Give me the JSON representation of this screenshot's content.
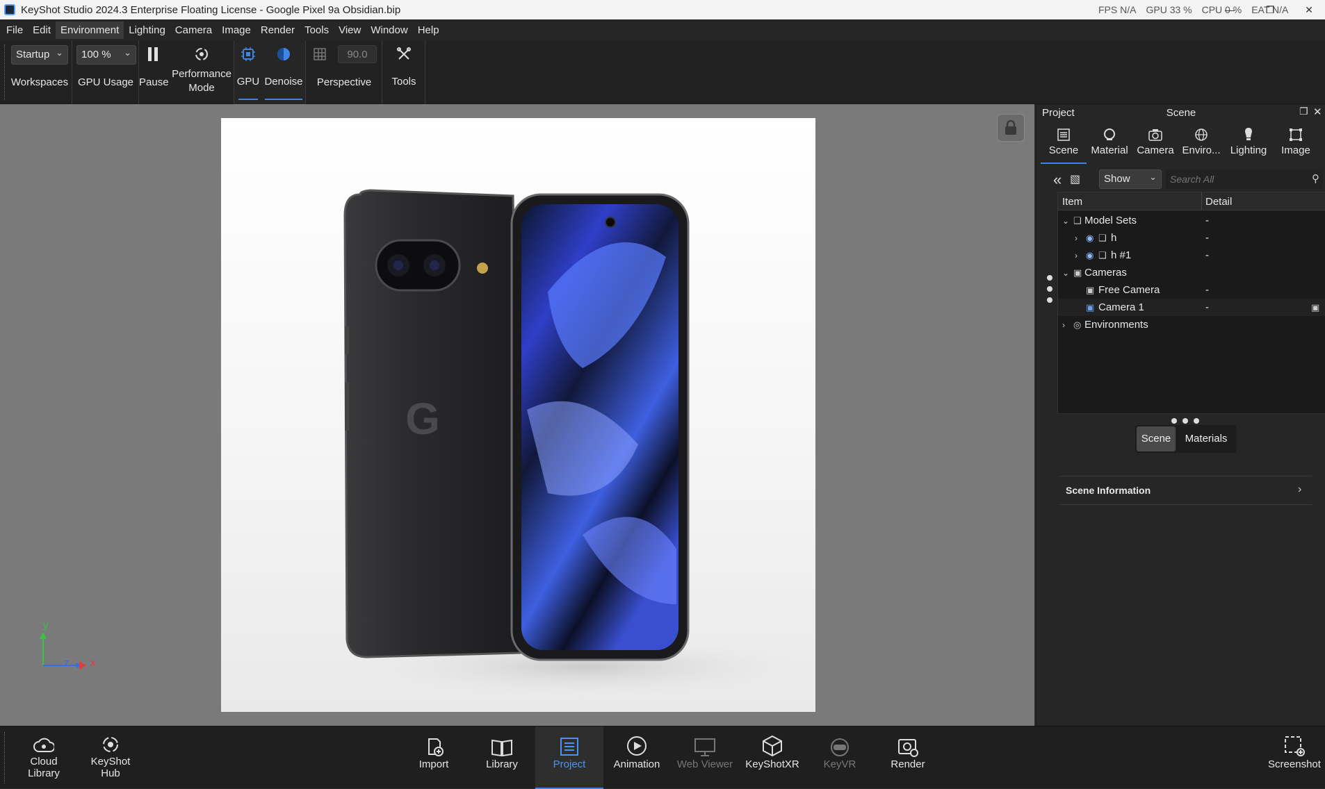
{
  "window": {
    "title": "KeyShot Studio 2024.3 Enterprise Floating License  - Google Pixel 9a Obsidian.bip",
    "stats": [
      "FPS N/A",
      "GPU 33 %",
      "CPU 0 %",
      "EAT N/A"
    ]
  },
  "menu": [
    "File",
    "Edit",
    "Environment",
    "Lighting",
    "Camera",
    "Image",
    "Render",
    "Tools",
    "View",
    "Window",
    "Help"
  ],
  "ribbon": {
    "workspace_value": "Startup",
    "workspaces_label": "Workspaces",
    "gpu_usage_value": "100 %",
    "gpu_usage_label": "GPU Usage",
    "pause_label": "Pause",
    "performance_label_1": "Performance",
    "performance_label_2": "Mode",
    "gpu_label": "GPU",
    "denoise_label": "Denoise",
    "fov_value": "90.0",
    "perspective_label": "Perspective",
    "tools_label": "Tools"
  },
  "viewport": {
    "axis_y": "y",
    "axis_z": "z",
    "axis_x": "x",
    "phone_logo": "G"
  },
  "panel": {
    "project_label": "Project",
    "scene_title": "Scene",
    "tabs": [
      "Scene",
      "Material",
      "Camera",
      "Enviro...",
      "Lighting",
      "Image"
    ],
    "show_value": "Show",
    "search_placeholder": "Search All",
    "col_item": "Item",
    "col_detail": "Detail",
    "tree": [
      {
        "label": "Model Sets",
        "detail": "-"
      },
      {
        "label": "h",
        "detail": "-"
      },
      {
        "label": "h #1",
        "detail": "-"
      },
      {
        "label": "Cameras",
        "detail": ""
      },
      {
        "label": "Free Camera",
        "detail": "-"
      },
      {
        "label": "Camera 1",
        "detail": "-"
      },
      {
        "label": "Environments",
        "detail": ""
      }
    ],
    "seg_scene": "Scene",
    "seg_materials": "Materials",
    "scene_info": "Scene Information"
  },
  "bottom": {
    "cloud_library_1": "Cloud",
    "cloud_library_2": "Library",
    "hub_1": "KeyShot",
    "hub_2": "Hub",
    "import": "Import",
    "library": "Library",
    "project": "Project",
    "animation": "Animation",
    "web_viewer": "Web Viewer",
    "keyshotxr": "KeyShotXR",
    "keyvr": "KeyVR",
    "render": "Render",
    "screenshot": "Screenshot"
  },
  "colors": {
    "accent": "#3d86e8",
    "axis_x": "#e23b3b",
    "axis_y": "#35c53c",
    "axis_z": "#3b6de2"
  }
}
